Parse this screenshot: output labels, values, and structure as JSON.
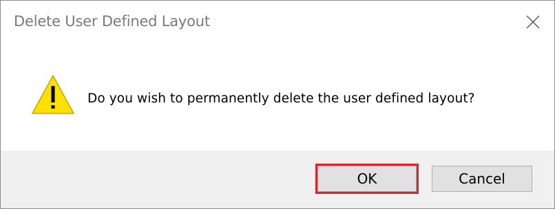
{
  "dialog": {
    "title": "Delete User Defined Layout",
    "message": "Do you wish to permanently delete the user defined layout?",
    "icon": "warning-icon",
    "buttons": {
      "ok_label": "OK",
      "cancel_label": "Cancel"
    },
    "highlighted_button": "OK"
  },
  "colors": {
    "warning_fill": "#FCE100",
    "highlight_border": "#E0202A"
  }
}
